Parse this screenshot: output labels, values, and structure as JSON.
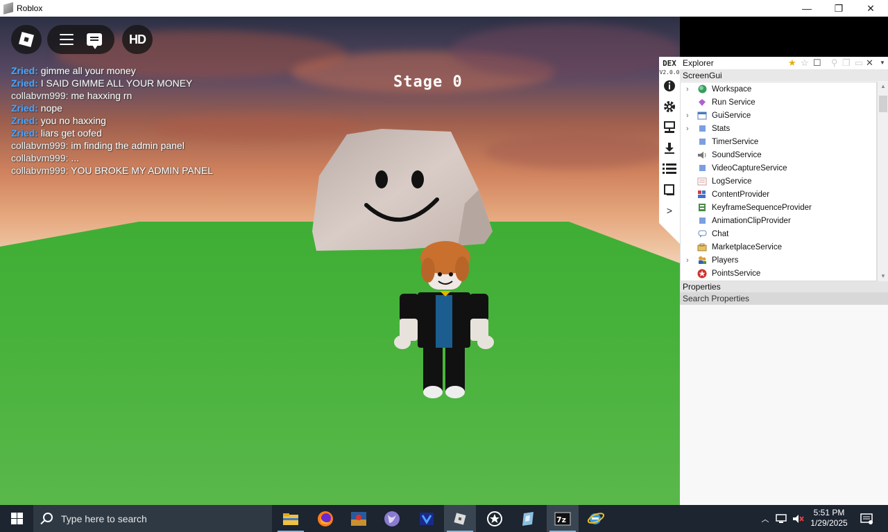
{
  "window": {
    "title": "Roblox",
    "minimize_glyph": "—",
    "maximize_glyph": "❐",
    "close_glyph": "✕"
  },
  "game": {
    "stage_label": "Stage 0",
    "hd_label": "HD"
  },
  "chat": {
    "messages": [
      {
        "user": "Zried:",
        "text": "gimme all your money"
      },
      {
        "user": "Zried:",
        "text": "I SAID GIMME ALL YOUR MONEY"
      },
      {
        "user": "collabvm999:",
        "text": "me haxxing rn"
      },
      {
        "user": "Zried:",
        "text": "nope"
      },
      {
        "user": "Zried:",
        "text": "you no haxxing"
      },
      {
        "user": "Zried:",
        "text": "liars get oofed"
      },
      {
        "user": "collabvm999:",
        "text": "im finding the admin panel"
      },
      {
        "user": "collabvm999:",
        "text": "..."
      },
      {
        "user": "collabvm999:",
        "text": "YOU BROKE MY ADMIN PANEL"
      }
    ]
  },
  "dex": {
    "logo": "DEX",
    "version": "V2.0.0",
    "side_more": ">",
    "header_title": "Explorer",
    "sub_title": "ScreenGui",
    "tree": [
      {
        "label": "Workspace",
        "icon": "globe-icon",
        "expandable": true
      },
      {
        "label": "Run Service",
        "icon": "gem-icon",
        "expandable": false
      },
      {
        "label": "GuiService",
        "icon": "window-icon",
        "expandable": true
      },
      {
        "label": "Stats",
        "icon": "square-icon",
        "expandable": true
      },
      {
        "label": "TimerService",
        "icon": "square-icon",
        "expandable": false
      },
      {
        "label": "SoundService",
        "icon": "speaker-icon",
        "expandable": false
      },
      {
        "label": "VideoCaptureService",
        "icon": "square-icon",
        "expandable": false
      },
      {
        "label": "LogService",
        "icon": "log-icon",
        "expandable": false
      },
      {
        "label": "ContentProvider",
        "icon": "provider-icon",
        "expandable": false
      },
      {
        "label": "KeyframeSequenceProvider",
        "icon": "keyframe-icon",
        "expandable": false
      },
      {
        "label": "AnimationClipProvider",
        "icon": "square-icon",
        "expandable": false
      },
      {
        "label": "Chat",
        "icon": "chat-bubble-icon",
        "expandable": false
      },
      {
        "label": "MarketplaceService",
        "icon": "market-icon",
        "expandable": false
      },
      {
        "label": "Players",
        "icon": "players-icon",
        "expandable": true
      },
      {
        "label": "PointsService",
        "icon": "points-icon",
        "expandable": false
      }
    ],
    "properties_title": "Properties",
    "properties_search": "Search Properties"
  },
  "taskbar": {
    "search_placeholder": "Type here to search",
    "time": "5:51 PM",
    "date": "1/29/2025"
  }
}
